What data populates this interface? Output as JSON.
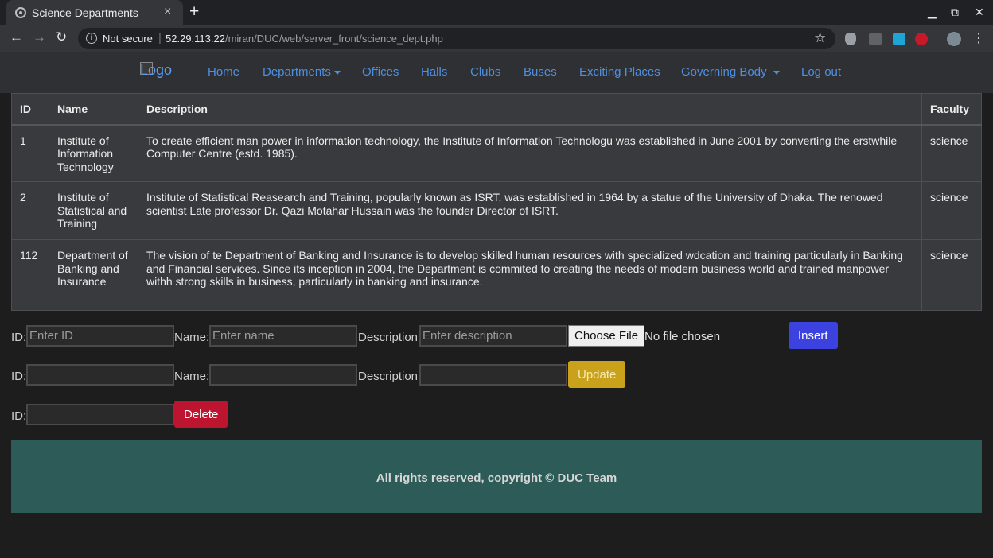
{
  "browser": {
    "tab_title": "Science Departments",
    "tab_close": "×",
    "new_tab": "+",
    "not_secure": "Not secure",
    "url_host": "52.29.113.22",
    "url_path": "/miran/DUC/web/server_front/science_dept.php",
    "minimize": "▁",
    "maximize": "⧉",
    "close": "✕"
  },
  "navbar": {
    "logo_alt": "Logo",
    "links": {
      "home": "Home",
      "departments": "Departments",
      "offices": "Offices",
      "halls": "Halls",
      "clubs": "Clubs",
      "buses": "Buses",
      "exciting_places": "Exciting Places",
      "governing_body": "Governing Body",
      "log_out": "Log out"
    }
  },
  "table": {
    "headers": {
      "id": "ID",
      "name": "Name",
      "description": "Description",
      "faculty": "Faculty"
    },
    "rows": [
      {
        "id": "1",
        "name": "Institute of Information Technology",
        "description": "To create efficient man power in information technology, the Institute of Information Technologu was established in June 2001 by converting the erstwhile Computer Centre (estd. 1985).",
        "faculty": "science"
      },
      {
        "id": "2",
        "name": "Institute of Statistical and Training",
        "description": "Institute of Statistical Reasearch and Training, popularly known as ISRT, was established in 1964 by a statue of the University of Dhaka. The renowed scientist Late professor Dr. Qazi Motahar Hussain was the founder Director of ISRT.",
        "faculty": "science"
      },
      {
        "id": "112",
        "name": "Department of Banking and Insurance",
        "description": "The vision of te Department of Banking and Insurance is to develop skilled human resources with specialized wdcation and training particularly in Banking and Financial services. Since its inception in 2004, the Department is commited to creating the needs of modern business world and trained manpower withh strong skills in business, particularly in banking and insurance.",
        "faculty": "science"
      }
    ]
  },
  "insert_form": {
    "id_label": "ID:",
    "id_placeholder": "Enter ID",
    "name_label": "Name:",
    "name_placeholder": "Enter name",
    "desc_label": "Description:",
    "desc_placeholder": "Enter description",
    "file_button": "Choose File",
    "file_status": "No file chosen",
    "submit": "Insert"
  },
  "update_form": {
    "id_label": "ID:",
    "name_label": "Name:",
    "desc_label": "Description:",
    "submit": "Update"
  },
  "delete_form": {
    "id_label": "ID:",
    "submit": "Delete"
  },
  "footer": {
    "text": "All rights reserved, copyright © DUC Team"
  },
  "colors": {
    "footer_bg": "#2c5b58",
    "insert_btn": "#3b42e0",
    "update_btn": "#c9a11a",
    "delete_btn": "#bd1430",
    "nav_link": "#4f8fe0"
  }
}
